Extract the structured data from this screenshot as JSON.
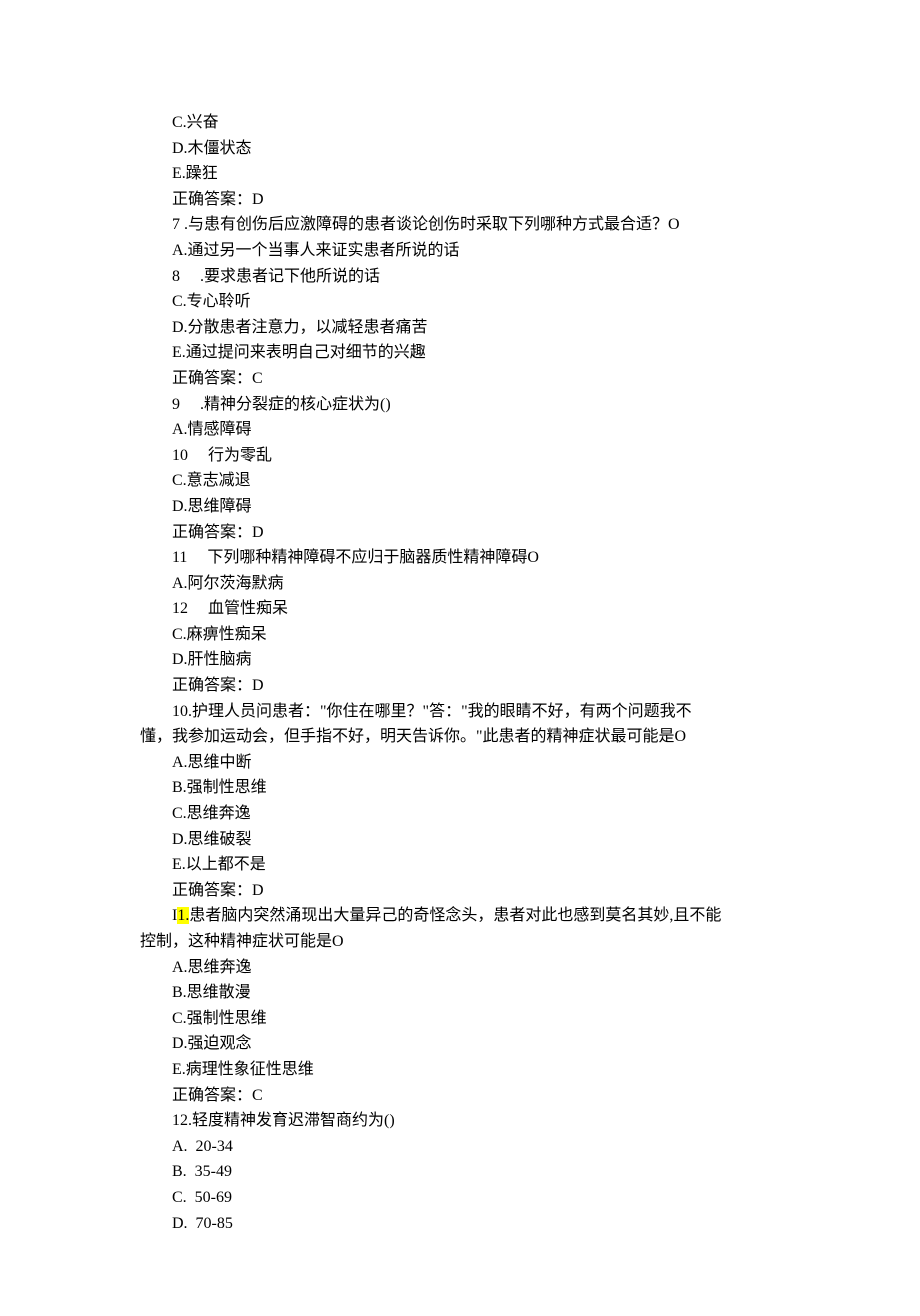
{
  "lines": [
    {
      "text": "C.兴奋"
    },
    {
      "text": "D.木僵状态"
    },
    {
      "text": "E.躁狂"
    },
    {
      "text": "正确答案：D"
    },
    {
      "text": "7 .与患有创伤后应激障碍的患者谈论创伤时采取下列哪种方式最合适？O"
    },
    {
      "text": "A.通过另一个当事人来证实患者所说的话"
    },
    {
      "text": "8     .要求患者记下他所说的话"
    },
    {
      "text": "C.专心聆听"
    },
    {
      "text": "D.分散患者注意力，以减轻患者痛苦"
    },
    {
      "text": "E.通过提问来表明自己对细节的兴趣"
    },
    {
      "text": "正确答案：C"
    },
    {
      "text": "9     .精神分裂症的核心症状为()"
    },
    {
      "text": "A.情感障碍"
    },
    {
      "text": "10     行为零乱"
    },
    {
      "text": "C.意志减退"
    },
    {
      "text": "D.思维障碍"
    },
    {
      "text": "正确答案：D"
    },
    {
      "text": "11     下列哪种精神障碍不应归于脑器质性精神障碍O"
    },
    {
      "text": "A.阿尔茨海默病"
    },
    {
      "text": "12     血管性痴呆"
    },
    {
      "text": "C.麻痹性痴呆"
    },
    {
      "text": "D.肝性脑病"
    },
    {
      "text": "正确答案：D"
    },
    {
      "text": "10.护理人员问患者：\"你住在哪里？\"答：\"我的眼睛不好，有两个问题我不"
    },
    {
      "text": "懂，我参加运动会，但手指不好，明天告诉你。\"此患者的精神症状最可能是O",
      "noindent": true
    },
    {
      "text": "A.思维中断"
    },
    {
      "text": "B.强制性思维"
    },
    {
      "text": "C.思维奔逸"
    },
    {
      "text": "D.思维破裂"
    },
    {
      "text": "E.以上都不是"
    },
    {
      "text": "正确答案：D"
    },
    {
      "text_parts": [
        {
          "t": "I"
        },
        {
          "t": "1.",
          "hl": true
        },
        {
          "t": "患者脑内突然涌现出大量异己的奇怪念头，患者对此也感到莫名其妙,且不能"
        }
      ]
    },
    {
      "text": "控制，这种精神症状可能是O",
      "noindent": true
    },
    {
      "text": "A.思维奔逸"
    },
    {
      "text": "B.思维散漫"
    },
    {
      "text": "C.强制性思维"
    },
    {
      "text": "D.强迫观念"
    },
    {
      "text": "E.病理性象征性思维"
    },
    {
      "text": "正确答案：C"
    },
    {
      "text": "12.轻度精神发育迟滞智商约为()"
    },
    {
      "text": "A.  20-34"
    },
    {
      "text": "B.  35-49"
    },
    {
      "text": "C.  50-69"
    },
    {
      "text": "D.  70-85"
    }
  ]
}
